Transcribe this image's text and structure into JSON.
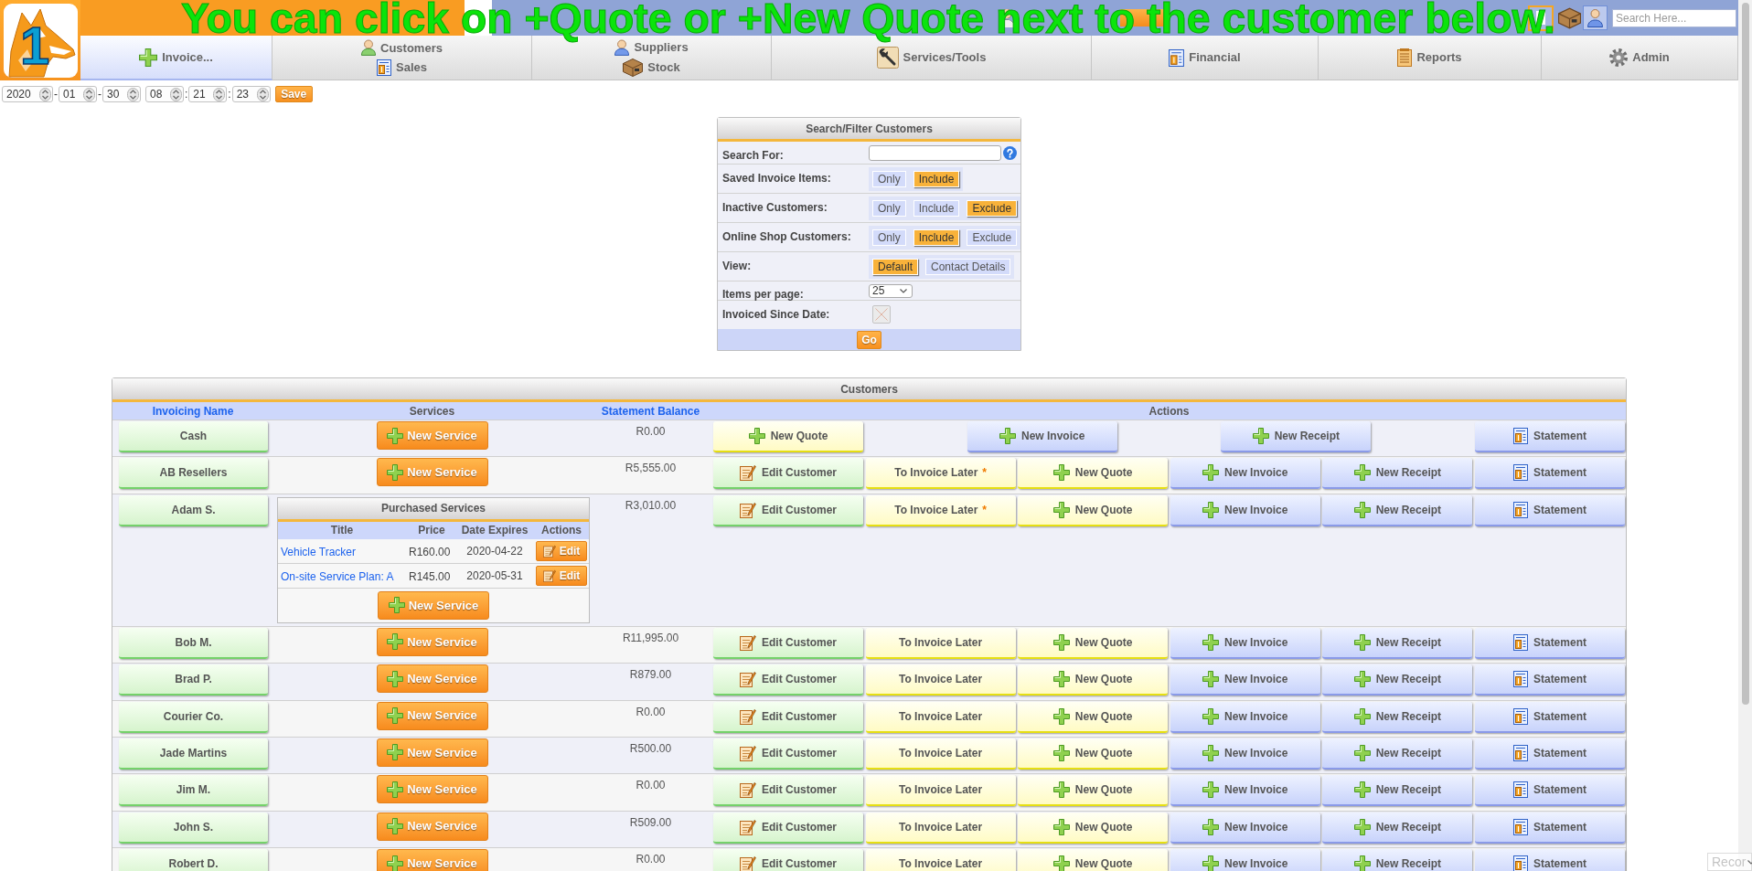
{
  "tutorial_caption": "You can click on +Quote or +New Quote next to the customer below.",
  "step_number": "1",
  "header": {
    "search": {
      "placeholder": "Search Here..."
    }
  },
  "nav": [
    {
      "selected": true,
      "items": [
        {
          "label": "Invoice..."
        }
      ]
    },
    {
      "selected": false,
      "items": [
        {
          "label": "Customers"
        },
        {
          "label": "Sales"
        }
      ]
    },
    {
      "selected": false,
      "items": [
        {
          "label": "Suppliers"
        },
        {
          "label": "Stock"
        }
      ]
    },
    {
      "selected": false,
      "items": [
        {
          "label": "Services/Tools"
        }
      ]
    },
    {
      "selected": false,
      "items": [
        {
          "label": "Financial"
        }
      ]
    },
    {
      "selected": false,
      "items": [
        {
          "label": "Reports"
        }
      ]
    },
    {
      "selected": false,
      "items": [
        {
          "label": "Admin"
        }
      ]
    }
  ],
  "datetime": {
    "fields": [
      {
        "value": "2020",
        "separator": "-"
      },
      {
        "value": "01",
        "separator": "-"
      },
      {
        "value": "30"
      },
      {
        "value": "08",
        "separator": ":"
      },
      {
        "value": "21",
        "separator": ":"
      },
      {
        "value": "23"
      }
    ],
    "save": "Save"
  },
  "filter": {
    "title": "Search/Filter Customers",
    "rows": [
      {
        "kind": "text",
        "label": "Search For:"
      },
      {
        "kind": "options",
        "label": "Saved Invoice Items:",
        "options": [
          {
            "label": "Only",
            "selected": false
          },
          {
            "label": "Include",
            "selected": true
          }
        ]
      },
      {
        "kind": "options",
        "label": "Inactive Customers:",
        "options": [
          {
            "label": "Only",
            "selected": false
          },
          {
            "label": "Include",
            "selected": false
          },
          {
            "label": "Exclude",
            "selected": true
          }
        ]
      },
      {
        "kind": "options",
        "label": "Online Shop Customers:",
        "options": [
          {
            "label": "Only",
            "selected": false
          },
          {
            "label": "Include",
            "selected": true
          },
          {
            "label": "Exclude",
            "selected": false
          }
        ]
      },
      {
        "kind": "options",
        "label": "View:",
        "options": [
          {
            "label": "Default",
            "selected": true
          },
          {
            "label": "Contact Details",
            "selected": false
          }
        ]
      },
      {
        "kind": "select",
        "label": "Items per page:",
        "value": "25"
      },
      {
        "kind": "date",
        "label": "Invoiced Since Date:"
      }
    ],
    "go": "Go"
  },
  "customers": {
    "title": "Customers",
    "columns": [
      {
        "label": "Invoicing Name",
        "sortable": true
      },
      {
        "label": "Services",
        "sortable": false
      },
      {
        "label": "Statement Balance",
        "sortable": true
      },
      {
        "label": "Actions",
        "sortable": false
      }
    ],
    "rows": [
      {
        "name": "Cash",
        "service_button": "New Service",
        "balance": "R0.00",
        "actions": [
          {
            "kind": "quote",
            "label": "New Quote"
          },
          {
            "kind": "invoice",
            "label": "New Invoice"
          },
          {
            "kind": "receipt",
            "label": "New Receipt"
          },
          {
            "kind": "statement",
            "label": "Statement"
          }
        ]
      },
      {
        "name": "AB Resellers",
        "service_button": "New Service",
        "balance": "R5,555.00",
        "actions": [
          {
            "kind": "edit",
            "label": "Edit Customer"
          },
          {
            "kind": "later",
            "label": "To Invoice Later",
            "mark": "*"
          },
          {
            "kind": "quote",
            "label": "New Quote"
          },
          {
            "kind": "invoice",
            "label": "New Invoice"
          },
          {
            "kind": "receipt",
            "label": "New Receipt"
          },
          {
            "kind": "statement",
            "label": "Statement"
          }
        ]
      },
      {
        "name": "Adam S.",
        "purchased_services": {
          "title": "Purchased Services",
          "columns": [
            "Title",
            "Price",
            "Date Expires",
            "Actions"
          ],
          "rows": [
            {
              "title": "Vehicle Tracker",
              "price": "R160.00",
              "expires": "2020-04-22",
              "action": "Edit"
            },
            {
              "title": "On-site Service Plan: A",
              "price": "R145.00",
              "expires": "2020-05-31",
              "action": "Edit"
            }
          ],
          "button": "New Service"
        },
        "balance": "R3,010.00",
        "actions": [
          {
            "kind": "edit",
            "label": "Edit Customer"
          },
          {
            "kind": "later",
            "label": "To Invoice Later",
            "mark": "*"
          },
          {
            "kind": "quote",
            "label": "New Quote"
          },
          {
            "kind": "invoice",
            "label": "New Invoice"
          },
          {
            "kind": "receipt",
            "label": "New Receipt"
          },
          {
            "kind": "statement",
            "label": "Statement"
          }
        ]
      },
      {
        "name": "Bob M.",
        "service_button": "New Service",
        "balance": "R11,995.00",
        "actions": [
          {
            "kind": "edit",
            "label": "Edit Customer"
          },
          {
            "kind": "later",
            "label": "To Invoice Later"
          },
          {
            "kind": "quote",
            "label": "New Quote"
          },
          {
            "kind": "invoice",
            "label": "New Invoice"
          },
          {
            "kind": "receipt",
            "label": "New Receipt"
          },
          {
            "kind": "statement",
            "label": "Statement"
          }
        ]
      },
      {
        "name": "Brad P.",
        "service_button": "New Service",
        "balance": "R879.00",
        "actions": [
          {
            "kind": "edit",
            "label": "Edit Customer"
          },
          {
            "kind": "later",
            "label": "To Invoice Later"
          },
          {
            "kind": "quote",
            "label": "New Quote"
          },
          {
            "kind": "invoice",
            "label": "New Invoice"
          },
          {
            "kind": "receipt",
            "label": "New Receipt"
          },
          {
            "kind": "statement",
            "label": "Statement"
          }
        ]
      },
      {
        "name": "Courier Co.",
        "service_button": "New Service",
        "balance": "R0.00",
        "actions": [
          {
            "kind": "edit",
            "label": "Edit Customer"
          },
          {
            "kind": "later",
            "label": "To Invoice Later"
          },
          {
            "kind": "quote",
            "label": "New Quote"
          },
          {
            "kind": "invoice",
            "label": "New Invoice"
          },
          {
            "kind": "receipt",
            "label": "New Receipt"
          },
          {
            "kind": "statement",
            "label": "Statement"
          }
        ]
      },
      {
        "name": "Jade Martins",
        "service_button": "New Service",
        "balance": "R500.00",
        "actions": [
          {
            "kind": "edit",
            "label": "Edit Customer"
          },
          {
            "kind": "later",
            "label": "To Invoice Later"
          },
          {
            "kind": "quote",
            "label": "New Quote"
          },
          {
            "kind": "invoice",
            "label": "New Invoice"
          },
          {
            "kind": "receipt",
            "label": "New Receipt"
          },
          {
            "kind": "statement",
            "label": "Statement"
          }
        ]
      },
      {
        "name": "Jim M.",
        "service_button": "New Service",
        "balance": "R0.00",
        "actions": [
          {
            "kind": "edit",
            "label": "Edit Customer"
          },
          {
            "kind": "later",
            "label": "To Invoice Later"
          },
          {
            "kind": "quote",
            "label": "New Quote"
          },
          {
            "kind": "invoice",
            "label": "New Invoice"
          },
          {
            "kind": "receipt",
            "label": "New Receipt"
          },
          {
            "kind": "statement",
            "label": "Statement"
          }
        ]
      },
      {
        "name": "John S.",
        "service_button": "New Service",
        "balance": "R509.00",
        "actions": [
          {
            "kind": "edit",
            "label": "Edit Customer"
          },
          {
            "kind": "later",
            "label": "To Invoice Later"
          },
          {
            "kind": "quote",
            "label": "New Quote"
          },
          {
            "kind": "invoice",
            "label": "New Invoice"
          },
          {
            "kind": "receipt",
            "label": "New Receipt"
          },
          {
            "kind": "statement",
            "label": "Statement"
          }
        ]
      },
      {
        "name": "Robert D.",
        "service_button": "New Service",
        "balance": "R0.00",
        "actions": [
          {
            "kind": "edit",
            "label": "Edit Customer"
          },
          {
            "kind": "later",
            "label": "To Invoice Later"
          },
          {
            "kind": "quote",
            "label": "New Quote"
          },
          {
            "kind": "invoice",
            "label": "New Invoice"
          },
          {
            "kind": "receipt",
            "label": "New Receipt"
          },
          {
            "kind": "statement",
            "label": "Statement"
          }
        ]
      }
    ]
  },
  "corner_badge": "Recor"
}
